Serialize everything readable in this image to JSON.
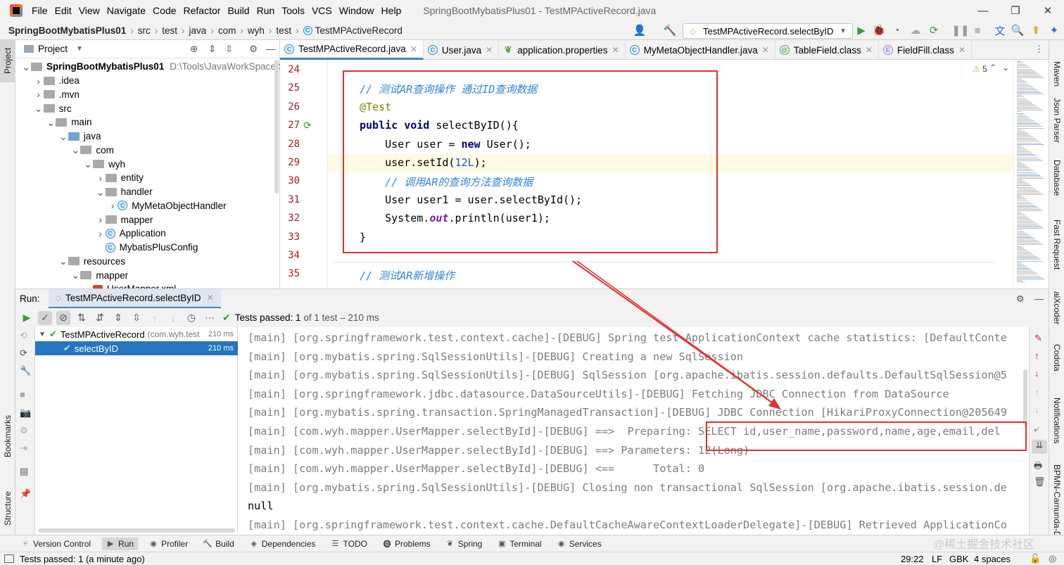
{
  "menu": {
    "items": [
      "File",
      "Edit",
      "View",
      "Navigate",
      "Code",
      "Refactor",
      "Build",
      "Run",
      "Tools",
      "VCS",
      "Window",
      "Help"
    ],
    "window_title": "SpringBootMybatisPlus01 - TestMPActiveRecord.java"
  },
  "breadcrumb": [
    "SpringBootMybatisPlus01",
    "src",
    "test",
    "java",
    "com",
    "wyh",
    "test",
    "TestMPActiveRecord"
  ],
  "run_config": "TestMPActiveRecord.selectByID",
  "left_strip": {
    "project": "Project",
    "bookmarks": "Bookmarks",
    "structure": "Structure"
  },
  "right_strip": [
    "Maven",
    "Json Parser",
    "Database",
    "Fast Request",
    "aiXcoder",
    "Codota",
    "Notifications",
    "BPMN-Camunda-D"
  ],
  "project_panel": {
    "title": "Project",
    "tree": [
      {
        "label": "SpringBootMybatisPlus01",
        "extra": "D:\\Tools\\JavaWorkSpace\\Sprin",
        "depth": 0,
        "open": true,
        "type": "module"
      },
      {
        "label": ".idea",
        "depth": 1,
        "open": false,
        "type": "folder"
      },
      {
        "label": ".mvn",
        "depth": 1,
        "open": false,
        "type": "folder"
      },
      {
        "label": "src",
        "depth": 1,
        "open": true,
        "type": "folder"
      },
      {
        "label": "main",
        "depth": 2,
        "open": true,
        "type": "folder"
      },
      {
        "label": "java",
        "depth": 3,
        "open": true,
        "type": "src"
      },
      {
        "label": "com",
        "depth": 4,
        "open": true,
        "type": "pkg"
      },
      {
        "label": "wyh",
        "depth": 5,
        "open": true,
        "type": "pkg"
      },
      {
        "label": "entity",
        "depth": 6,
        "open": false,
        "type": "pkg"
      },
      {
        "label": "handler",
        "depth": 6,
        "open": true,
        "type": "pkg"
      },
      {
        "label": "MyMetaObjectHandler",
        "depth": 7,
        "open": false,
        "type": "class"
      },
      {
        "label": "mapper",
        "depth": 6,
        "open": false,
        "type": "pkg"
      },
      {
        "label": "Application",
        "depth": 6,
        "open": false,
        "type": "class"
      },
      {
        "label": "MybatisPlusConfig",
        "depth": 6,
        "open": null,
        "type": "class"
      },
      {
        "label": "resources",
        "depth": 3,
        "open": true,
        "type": "folder"
      },
      {
        "label": "mapper",
        "depth": 4,
        "open": true,
        "type": "folder"
      },
      {
        "label": "UserMapper.xml",
        "depth": 5,
        "open": null,
        "type": "xml"
      }
    ]
  },
  "editor_tabs": [
    {
      "label": "TestMPActiveRecord.java",
      "active": true,
      "icon": "C",
      "color": "#3592c4"
    },
    {
      "label": "User.java",
      "active": false,
      "icon": "C",
      "color": "#3592c4"
    },
    {
      "label": "application.properties",
      "active": false,
      "icon": "leaf",
      "color": "#6da34d"
    },
    {
      "label": "MyMetaObjectHandler.java",
      "active": false,
      "icon": "C",
      "color": "#3592c4"
    },
    {
      "label": "TableField.class",
      "active": false,
      "icon": "@",
      "color": "#6da34d"
    },
    {
      "label": "FieldFill.class",
      "active": false,
      "icon": "E",
      "color": "#9d7cd8"
    }
  ],
  "editor": {
    "warnings": "5",
    "line_numbers": [
      "24",
      "25",
      "26",
      "27",
      "28",
      "29",
      "30",
      "31",
      "32",
      "33",
      "34",
      "35"
    ],
    "code": {
      "l25_comment": "// 测试AR查询操作 通过ID查询数据",
      "l26_annotation": "@Test",
      "l27_kw": "public void",
      "l27_rest": " selectByID(){",
      "l28_a": "    User user = ",
      "l28_kw": "new",
      "l28_b": " User();",
      "l29_a": "    user.setId(",
      "l29_num": "12L",
      "l29_b": ");",
      "l30_comment": "    // 调用AR的查询方法查询数据",
      "l31": "    User user1 = user.selectById();",
      "l32_a": "    System.",
      "l32_field": "out",
      "l32_b": ".println(user1);",
      "l33": "}",
      "l35_comment": "// 测试AR新增操作"
    }
  },
  "run_panel": {
    "label": "Run:",
    "tab": "TestMPActiveRecord.selectByID",
    "status_prefix": "Tests passed:",
    "status_count": "1",
    "status_suffix": "of 1 test – 210 ms",
    "tests": [
      {
        "name": "TestMPActiveRecord",
        "detail": "(com.wyh.test",
        "time": "210 ms"
      },
      {
        "name": "selectByID",
        "detail": "",
        "time": "210 ms"
      }
    ],
    "console": [
      "[main] [org.springframework.test.context.cache]-[DEBUG] Spring test ApplicationContext cache statistics: [DefaultConte",
      "[main] [org.mybatis.spring.SqlSessionUtils]-[DEBUG] Creating a new SqlSession",
      "[main] [org.mybatis.spring.SqlSessionUtils]-[DEBUG] SqlSession [org.apache.ibatis.session.defaults.DefaultSqlSession@5",
      "[main] [org.springframework.jdbc.datasource.DataSourceUtils]-[DEBUG] Fetching JDBC Connection from DataSource",
      "[main] [org.mybatis.spring.transaction.SpringManagedTransaction]-[DEBUG] JDBC Connection [HikariProxyConnection@205649",
      "[main] [com.wyh.mapper.UserMapper.selectById]-[DEBUG] ==>  Preparing: SELECT id,user_name,password,name,age,email,del",
      "[main] [com.wyh.mapper.UserMapper.selectById]-[DEBUG] ==> Parameters: 12(Long)",
      "[main] [com.wyh.mapper.UserMapper.selectById]-[DEBUG] <==      Total: 0",
      "[main] [org.mybatis.spring.SqlSessionUtils]-[DEBUG] Closing non transactional SqlSession [org.apache.ibatis.session.de",
      "null",
      "[main] [org.springframework.test.context.cache.DefaultCacheAwareContextLoaderDelegate]-[DEBUG] Retrieved ApplicationCo"
    ]
  },
  "bottom_tools": [
    "Version Control",
    "Run",
    "Profiler",
    "Build",
    "Dependencies",
    "TODO",
    "Problems",
    "Spring",
    "Terminal",
    "Services"
  ],
  "status": {
    "message": "Tests passed: 1 (a minute ago)",
    "position": "29:22",
    "line_sep": "LF",
    "encoding": "GBK",
    "indent": "4 spaces",
    "watermark": "@稀土掘金技术社区"
  }
}
